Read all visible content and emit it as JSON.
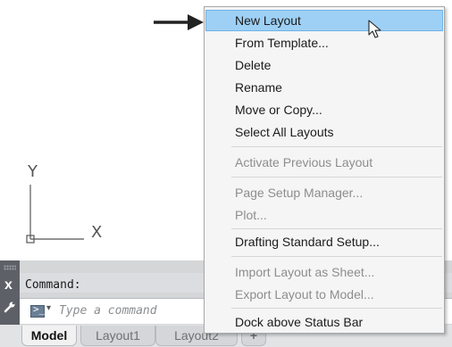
{
  "context_menu": {
    "items": [
      {
        "label": "New Layout",
        "enabled": true,
        "highlighted": true
      },
      {
        "label": "From Template...",
        "enabled": true
      },
      {
        "label": "Delete",
        "enabled": true
      },
      {
        "label": "Rename",
        "enabled": true
      },
      {
        "label": "Move or Copy...",
        "enabled": true
      },
      {
        "label": "Select All Layouts",
        "enabled": true
      },
      {
        "label": "Activate Previous Layout",
        "enabled": false
      },
      {
        "label": "Page Setup Manager...",
        "enabled": false
      },
      {
        "label": "Plot...",
        "enabled": false
      },
      {
        "label": "Drafting Standard Setup...",
        "enabled": true
      },
      {
        "label": "Import Layout as Sheet...",
        "enabled": false
      },
      {
        "label": "Export Layout to Model...",
        "enabled": false
      },
      {
        "label": "Dock above Status Bar",
        "enabled": true
      }
    ]
  },
  "ucs_icon": {
    "y_label": "Y",
    "x_label": "X"
  },
  "command_window": {
    "history_text": "Command:",
    "input_placeholder": "Type a command",
    "close_glyph": "x",
    "prompt_glyph": ">_",
    "dropdown_glyph": "▾"
  },
  "layout_tabs": {
    "tabs": [
      {
        "label": "Model",
        "active": true
      },
      {
        "label": "Layout1",
        "active": false
      },
      {
        "label": "Layout2",
        "active": false
      }
    ],
    "add_label": "+"
  },
  "colors": {
    "highlight": "#9ed0f5",
    "menu_background": "#f5f5f5",
    "disabled_text": "#8d8d8d"
  }
}
